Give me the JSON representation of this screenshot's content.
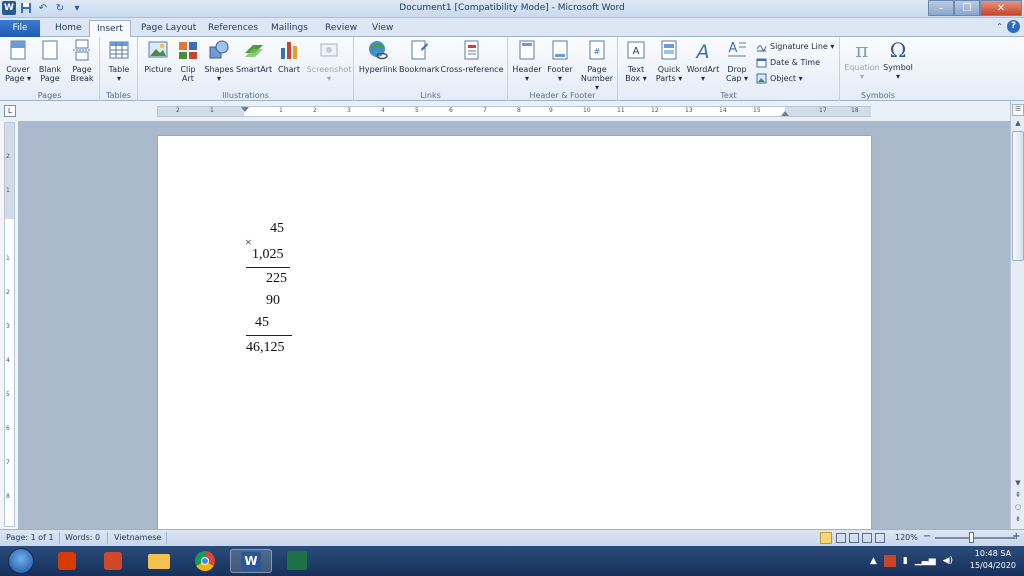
{
  "window": {
    "title": "Document1 [Compatibility Mode]  -  Microsoft Word"
  },
  "quick_access": {
    "app_icon": "word-app-icon",
    "app_letter": "W",
    "save_icon": "save-icon",
    "undo_icon": "undo-icon",
    "redo_icon": "redo-icon",
    "customize_icon": "customize-qat-icon"
  },
  "window_controls": {
    "minimize": "minimize-icon",
    "restore": "restore-icon",
    "close": "close-icon"
  },
  "tabs": {
    "file": "File",
    "home": "Home",
    "insert": "Insert",
    "page_layout": "Page Layout",
    "references": "References",
    "mailings": "Mailings",
    "review": "Review",
    "view": "View"
  },
  "help_button": "?",
  "ribbon": {
    "pages": {
      "label": "Pages",
      "cover_page": "Cover\nPage ▾",
      "blank_page": "Blank\nPage",
      "page_break": "Page\nBreak"
    },
    "tables": {
      "label": "Tables",
      "table": "Table\n▾"
    },
    "illustrations": {
      "label": "Illustrations",
      "picture": "Picture",
      "clip_art": "Clip\nArt",
      "shapes": "Shapes\n▾",
      "smartart": "SmartArt",
      "chart": "Chart",
      "screenshot": "Screenshot\n▾"
    },
    "links": {
      "label": "Links",
      "hyperlink": "Hyperlink",
      "bookmark": "Bookmark",
      "cross_reference": "Cross-reference"
    },
    "header_footer": {
      "label": "Header & Footer",
      "header": "Header\n▾",
      "footer": "Footer\n▾",
      "page_number": "Page\nNumber ▾"
    },
    "text": {
      "label": "Text",
      "text_box": "Text\nBox ▾",
      "quick_parts": "Quick\nParts ▾",
      "wordart": "WordArt\n▾",
      "drop_cap": "Drop\nCap ▾",
      "signature_line": "Signature Line ▾",
      "date_time": "Date & Time",
      "object": "Object ▾"
    },
    "symbols": {
      "label": "Symbols",
      "equation": "Equation\n▾",
      "symbol": "Symbol\n▾"
    }
  },
  "ruler": {
    "tab_selector": "L",
    "horizontal_numbers": [
      "2",
      "1",
      "1",
      "2",
      "3",
      "4",
      "5",
      "6",
      "7",
      "8",
      "9",
      "10",
      "11",
      "12",
      "13",
      "14",
      "15",
      "17",
      "18"
    ],
    "vertical_numbers": [
      "2",
      "1",
      "1",
      "2",
      "3",
      "4",
      "5",
      "6",
      "7",
      "8"
    ]
  },
  "document": {
    "multiplicand": "45",
    "operator": "×",
    "multiplier": "1,025",
    "partial_1": "225",
    "partial_2": "90",
    "partial_3": "45",
    "result": "46,125"
  },
  "status_bar": {
    "page": "Page: 1 of 1",
    "words": "Words: 0",
    "language": "Vietnamese",
    "zoom": "120%",
    "zoom_out": "−",
    "zoom_in": "+"
  },
  "taskbar": {
    "time": "10:48 SA",
    "date": "15/04/2020"
  }
}
